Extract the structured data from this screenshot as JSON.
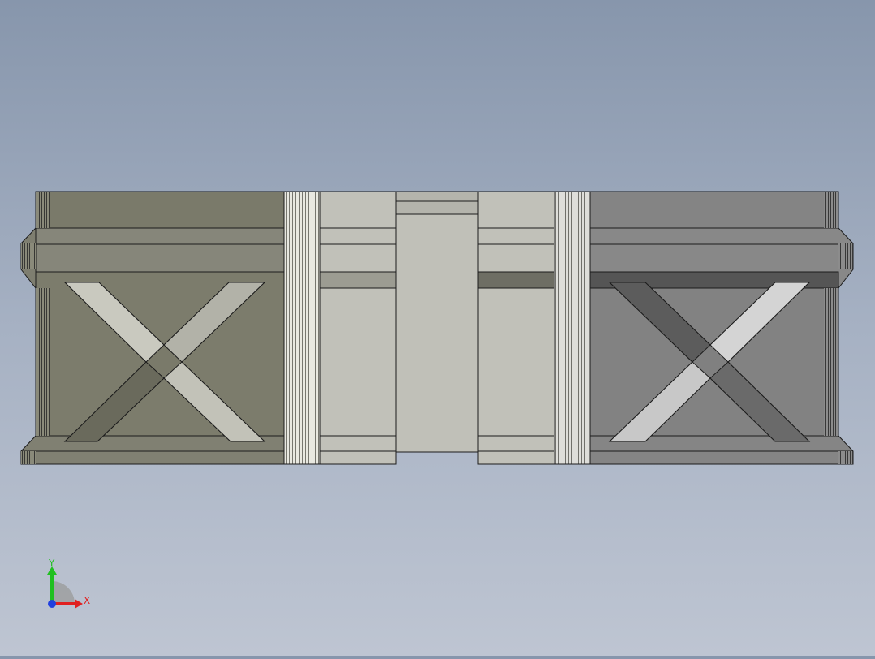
{
  "viewport": {
    "background_top": "#8796ac",
    "background_bottom": "#bec5d2"
  },
  "model": {
    "left_panel_color": "#7c7c6c",
    "right_panel_color": "#828282",
    "light_face_color": "#c1c1b9",
    "emblem": "x-cross"
  },
  "triad": {
    "x_label": "X",
    "y_label": "Y",
    "x_color": "#e02020",
    "y_color": "#20c020",
    "z_color": "#2040e0"
  }
}
